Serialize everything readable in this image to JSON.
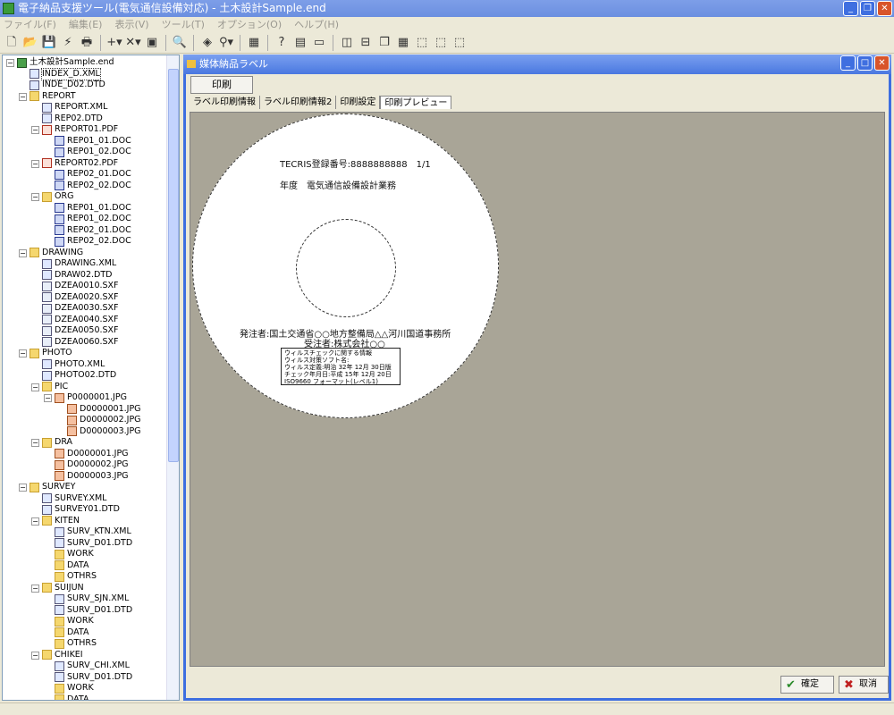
{
  "window": {
    "title": "電子納品支援ツール(電気通信設備対応) - 土木設計Sample.end"
  },
  "menu": [
    "ファイル(F)",
    "編集(E)",
    "表示(V)",
    "ツール(T)",
    "オプション(O)",
    "ヘルプ(H)"
  ],
  "toolbar": [
    [
      "new-icon",
      "🗋"
    ],
    [
      "open-icon",
      "📂"
    ],
    [
      "save-icon",
      "💾"
    ],
    [
      "flash-icon",
      "⚡"
    ],
    [
      "web-icon",
      "🖶"
    ],
    "|",
    [
      "add-icon",
      "+▾"
    ],
    [
      "delete-icon",
      "✕▾"
    ],
    [
      "properties-icon",
      "▣"
    ],
    "|",
    [
      "preview-icon",
      "🔍"
    ],
    "|",
    [
      "check-icon",
      "◈"
    ],
    [
      "find-icon",
      "⚲▾"
    ],
    "|",
    [
      "settings-icon",
      "▦"
    ],
    "|",
    [
      "help-icon",
      "?"
    ],
    [
      "panel-icon",
      "▤"
    ],
    [
      "card-icon",
      "▭"
    ],
    "|",
    [
      "layout-v-icon",
      "◫"
    ],
    [
      "layout-h-icon",
      "⊟"
    ],
    [
      "cascade-icon",
      "❐"
    ],
    [
      "grid-icon",
      "▦"
    ],
    [
      "view1-icon",
      "⬚"
    ],
    [
      "view2-icon",
      "⬚"
    ],
    [
      "view3-icon",
      "⬚"
    ]
  ],
  "tree": [
    [
      "土木設計Sample.end",
      0,
      "root",
      "-"
    ],
    [
      "INDEX_D.XML",
      1,
      "xml",
      "sel"
    ],
    [
      "INDE_D02.DTD",
      1,
      "xml"
    ],
    [
      "REPORT",
      1,
      "folder",
      "-"
    ],
    [
      "REPORT.XML",
      2,
      "xml"
    ],
    [
      "REP02.DTD",
      2,
      "xml"
    ],
    [
      "REPORT01.PDF",
      2,
      "pdf",
      "-"
    ],
    [
      "REP01_01.DOC",
      3,
      "doc"
    ],
    [
      "REP01_02.DOC",
      3,
      "doc"
    ],
    [
      "REPORT02.PDF",
      2,
      "pdf",
      "-"
    ],
    [
      "REP02_01.DOC",
      3,
      "doc"
    ],
    [
      "REP02_02.DOC",
      3,
      "doc"
    ],
    [
      "ORG",
      2,
      "folder",
      "-"
    ],
    [
      "REP01_01.DOC",
      3,
      "doc"
    ],
    [
      "REP01_02.DOC",
      3,
      "doc"
    ],
    [
      "REP02_01.DOC",
      3,
      "doc"
    ],
    [
      "REP02_02.DOC",
      3,
      "doc"
    ],
    [
      "DRAWING",
      1,
      "folder",
      "-"
    ],
    [
      "DRAWING.XML",
      2,
      "xml"
    ],
    [
      "DRAW02.DTD",
      2,
      "xml"
    ],
    [
      "DZEA0010.SXF",
      2,
      "sxf"
    ],
    [
      "DZEA0020.SXF",
      2,
      "sxf"
    ],
    [
      "DZEA0030.SXF",
      2,
      "sxf"
    ],
    [
      "DZEA0040.SXF",
      2,
      "sxf"
    ],
    [
      "DZEA0050.SXF",
      2,
      "sxf"
    ],
    [
      "DZEA0060.SXF",
      2,
      "sxf"
    ],
    [
      "PHOTO",
      1,
      "folder",
      "-"
    ],
    [
      "PHOTO.XML",
      2,
      "xml"
    ],
    [
      "PHOTO02.DTD",
      2,
      "xml"
    ],
    [
      "PIC",
      2,
      "folder",
      "-"
    ],
    [
      "P0000001.JPG",
      3,
      "jpg",
      "-"
    ],
    [
      "D0000001.JPG",
      4,
      "jpg"
    ],
    [
      "D0000002.JPG",
      4,
      "jpg"
    ],
    [
      "D0000003.JPG",
      4,
      "jpg"
    ],
    [
      "DRA",
      2,
      "folder",
      "-"
    ],
    [
      "D0000001.JPG",
      3,
      "jpg"
    ],
    [
      "D0000002.JPG",
      3,
      "jpg"
    ],
    [
      "D0000003.JPG",
      3,
      "jpg"
    ],
    [
      "SURVEY",
      1,
      "folder",
      "-"
    ],
    [
      "SURVEY.XML",
      2,
      "xml"
    ],
    [
      "SURVEY01.DTD",
      2,
      "xml"
    ],
    [
      "KITEN",
      2,
      "folder",
      "-"
    ],
    [
      "SURV_KTN.XML",
      3,
      "xml"
    ],
    [
      "SURV_D01.DTD",
      3,
      "xml"
    ],
    [
      "WORK",
      3,
      "folder"
    ],
    [
      "DATA",
      3,
      "folder"
    ],
    [
      "OTHRS",
      3,
      "folder"
    ],
    [
      "SUIJUN",
      2,
      "folder",
      "-"
    ],
    [
      "SURV_SJN.XML",
      3,
      "xml"
    ],
    [
      "SURV_D01.DTD",
      3,
      "xml"
    ],
    [
      "WORK",
      3,
      "folder"
    ],
    [
      "DATA",
      3,
      "folder"
    ],
    [
      "OTHRS",
      3,
      "folder"
    ],
    [
      "CHIKEI",
      2,
      "folder",
      "-"
    ],
    [
      "SURV_CHI.XML",
      3,
      "xml"
    ],
    [
      "SURV_D01.DTD",
      3,
      "xml"
    ],
    [
      "WORK",
      3,
      "folder"
    ],
    [
      "DATA",
      3,
      "folder"
    ]
  ],
  "dialog": {
    "title": "媒体納品ラベル",
    "print": "印刷",
    "tabs": [
      "ラベル印刷情報",
      "ラベル印刷情報2",
      "印刷設定",
      "印刷プレビュー"
    ],
    "active_tab": 3,
    "ok": "確定",
    "cancel": "取消"
  },
  "label": {
    "tecris": "TECRIS登録番号:8888888888　1/1",
    "project": "年度　電気通信設備設計業務",
    "orderer": "発注者:国土交通省○○地方整備局△△河川国道事務所",
    "contractor": "受注者:株式会社○○",
    "virus": [
      "ウィルスチェックに関する情報",
      "ウィルス対策ソフト名:",
      "ウィルス定義:明治 32年 12月 30日版",
      "チェック年月日:平成 15年 12月 20日",
      "ISO9660 フォーマット(レベル1)"
    ]
  }
}
